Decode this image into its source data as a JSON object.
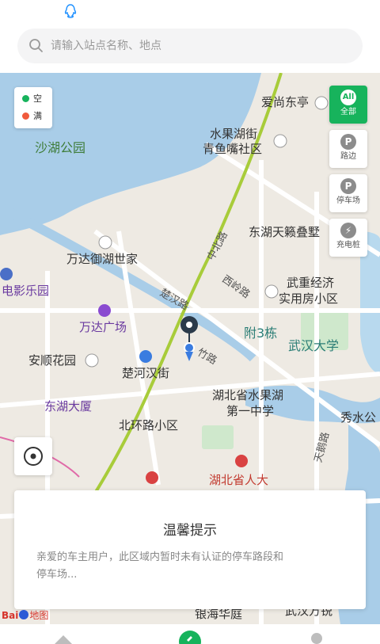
{
  "search": {
    "placeholder": "请输入站点名称、地点"
  },
  "legend": {
    "items": [
      {
        "label": "空",
        "color": "#17b35c"
      },
      {
        "label": "满",
        "color": "#f05a3c"
      }
    ]
  },
  "filters": [
    {
      "label": "全部",
      "icon": "All",
      "active": true
    },
    {
      "label": "路边",
      "icon": "P",
      "active": false
    },
    {
      "label": "停车场",
      "icon": "P",
      "active": false
    },
    {
      "label": "充电桩",
      "icon": "⚡",
      "active": false
    }
  ],
  "map": {
    "labels": {
      "shahu": "沙湖公园",
      "aishang": "爱尚东亭",
      "shuiguo": "水果湖街",
      "qingyu": "青鱼嘴社区",
      "donghu_tian": "东湖天籁叠墅",
      "zhongbei": "中北路",
      "wanda_yuhu": "万达御湖世家",
      "dianying": "电影乐园",
      "xiling": "西岭路",
      "wuzhong1": "武重经济",
      "wuzhong2": "实用房小区",
      "chuhan_road": "楚汉路",
      "wanda_gc": "万达广场",
      "fu3": "附3栋",
      "whu": "武汉大学",
      "zhu_road": "竹路",
      "anshun": "安顺花园",
      "chuhe": "楚河汉街",
      "donghu_dasha": "东湖大厦",
      "shuiguo_zx1": "湖北省水果湖",
      "shuiguo_zx2": "第一中学",
      "xiushui": "秀水公",
      "beihuan": "北环路小区",
      "tianhe_road": "天鹅路",
      "rd_hubei": "湖北省人大",
      "yinhai": "银海华庭",
      "wuhan_fw": "武汉方锐"
    }
  },
  "tip": {
    "title": "温馨提示",
    "message": "亲爱的车主用户，此区域内暂时未有认证的停车路段和停车场..."
  },
  "baidu": {
    "brand": "Bai",
    "suffix": "地图"
  }
}
